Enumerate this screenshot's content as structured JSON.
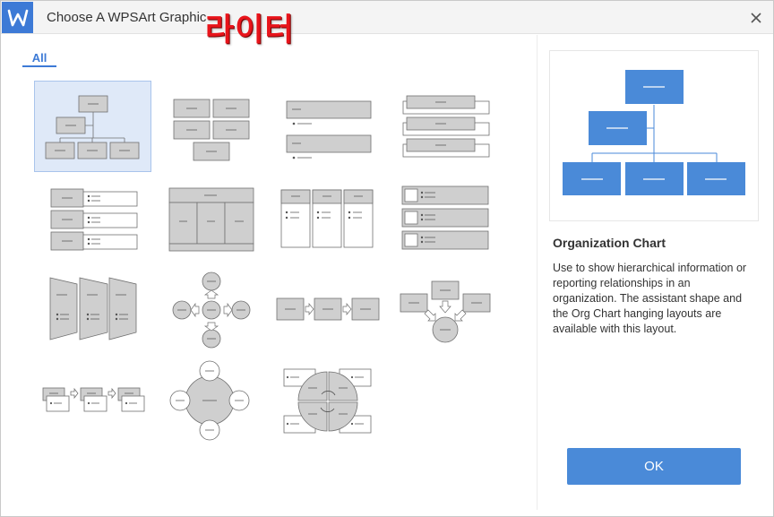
{
  "window": {
    "title": "Choose A WPSArt Graphic",
    "watermark": "라이터",
    "close_icon": "close-icon",
    "logo_icon": "wps-logo-icon"
  },
  "tabs": [
    {
      "label": "All",
      "selected": true
    }
  ],
  "gallery": {
    "selected_index": 0,
    "item_count": 15
  },
  "preview": {
    "title": "Organization Chart",
    "description": "Use to show hierarchical information or reporting relationships in an organization. The assistant shape and the Org Chart hanging layouts are available with this layout."
  },
  "actions": {
    "ok_label": "OK"
  },
  "colors": {
    "accent": "#3d7ad6",
    "ok_button": "#4a8ad8",
    "preview_shape": "#4a8ad8",
    "selected_bg": "#dfe9f8",
    "watermark": "#e8141b"
  }
}
